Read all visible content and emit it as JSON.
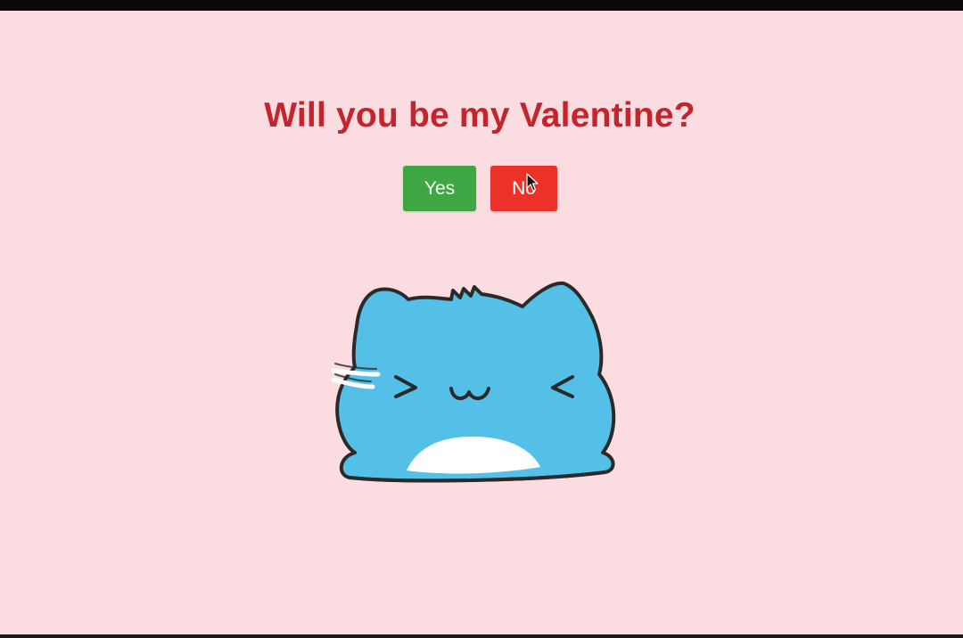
{
  "page": {
    "title": "Will you be my Valentine?"
  },
  "buttons": {
    "yes_label": "Yes",
    "no_label": "No"
  },
  "illustration": {
    "name": "blue-cat-icon"
  },
  "colors": {
    "background": "#fbdde1",
    "title": "#c4242c",
    "yes_button": "#3ea743",
    "no_button": "#eb3128",
    "cat_body": "#54c0e8"
  }
}
